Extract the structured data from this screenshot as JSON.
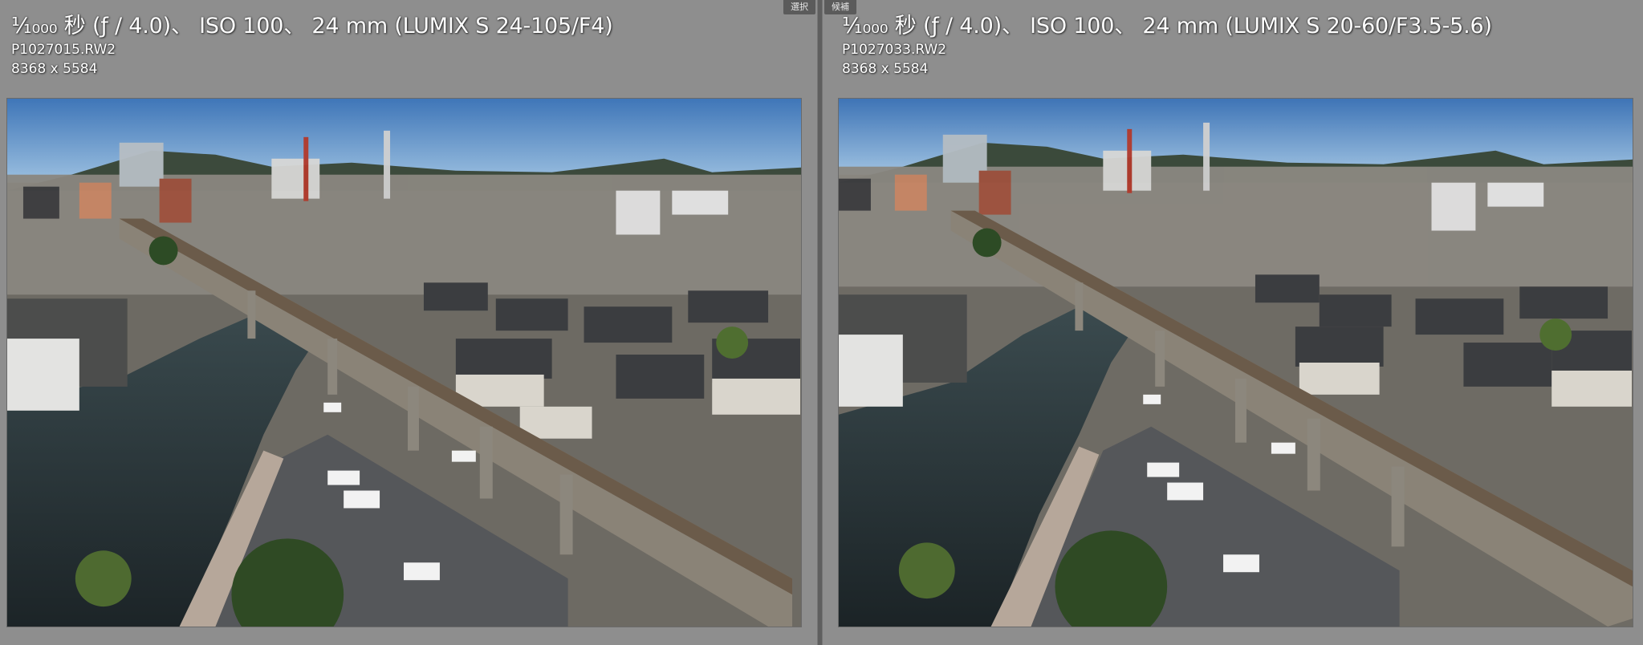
{
  "compare": {
    "select": {
      "tag": "選択",
      "exif": "¹⁄₁₀₀₀ 秒 (ƒ / 4.0)、 ISO 100、 24 mm (LUMIX S 24-105/F4)",
      "filename": "P1027015.RW2",
      "dimensions": "8368 x 5584"
    },
    "candidate": {
      "tag": "候補",
      "exif": "¹⁄₁₀₀₀ 秒 (ƒ / 4.0)、 ISO 100、 24 mm (LUMIX S 20-60/F3.5-5.6)",
      "filename": "P1027033.RW2",
      "dimensions": "8368 x 5584"
    }
  },
  "colors": {
    "background": "#8e8e8e",
    "tag_background": "#5b5b5b",
    "divider": "#5f5f5f",
    "overlay_text": "#ffffff"
  }
}
